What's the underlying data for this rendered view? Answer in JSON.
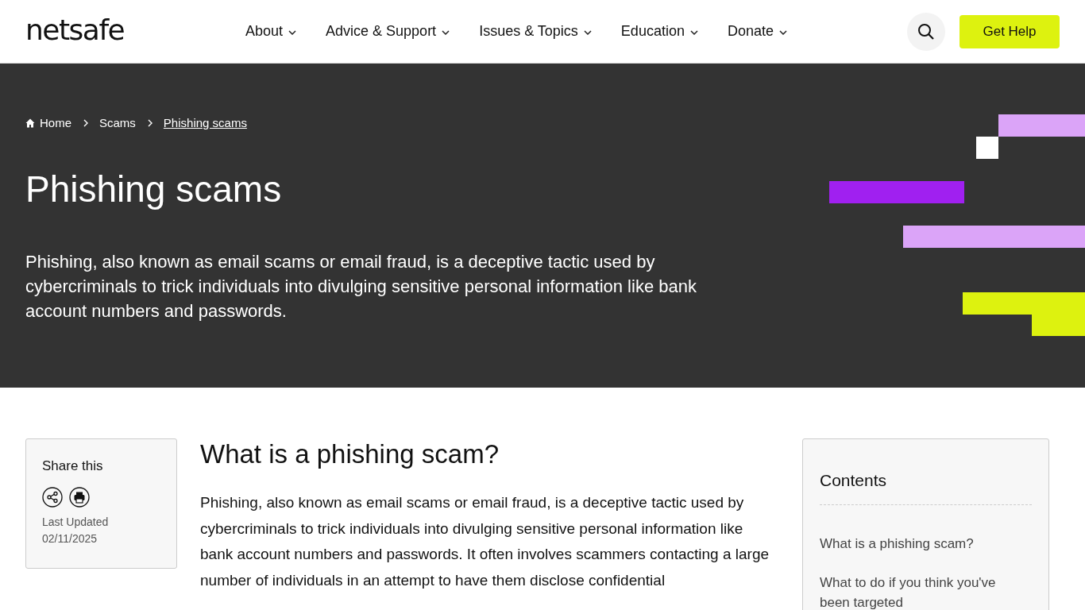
{
  "header": {
    "logo": "netsafe",
    "nav": [
      {
        "label": "About"
      },
      {
        "label": "Advice & Support"
      },
      {
        "label": "Issues & Topics"
      },
      {
        "label": "Education"
      },
      {
        "label": "Donate"
      }
    ],
    "cta": "Get Help"
  },
  "hero": {
    "breadcrumbs": [
      {
        "label": "Home",
        "current": false
      },
      {
        "label": "Scams",
        "current": false
      },
      {
        "label": "Phishing scams",
        "current": true
      }
    ],
    "title": "Phishing scams",
    "intro": "Phishing, also known as email scams or email fraud, is a deceptive tactic used by cybercriminals to trick individuals into divulging sensitive personal information like bank account numbers and passwords."
  },
  "share": {
    "title": "Share this",
    "updated_label": "Last Updated",
    "updated_date": "02/11/2025"
  },
  "article": {
    "heading": "What is a phishing scam?",
    "paragraph": "Phishing, also known as email scams or email fraud, is a deceptive tactic used by cybercriminals to trick individuals into divulging sensitive personal information like bank account numbers and passwords. It often involves scammers contacting a large number of individuals in an attempt to have them disclose confidential"
  },
  "contents": {
    "title": "Contents",
    "items": [
      "What is a phishing scam?",
      "What to do if you think you've been targeted"
    ]
  }
}
